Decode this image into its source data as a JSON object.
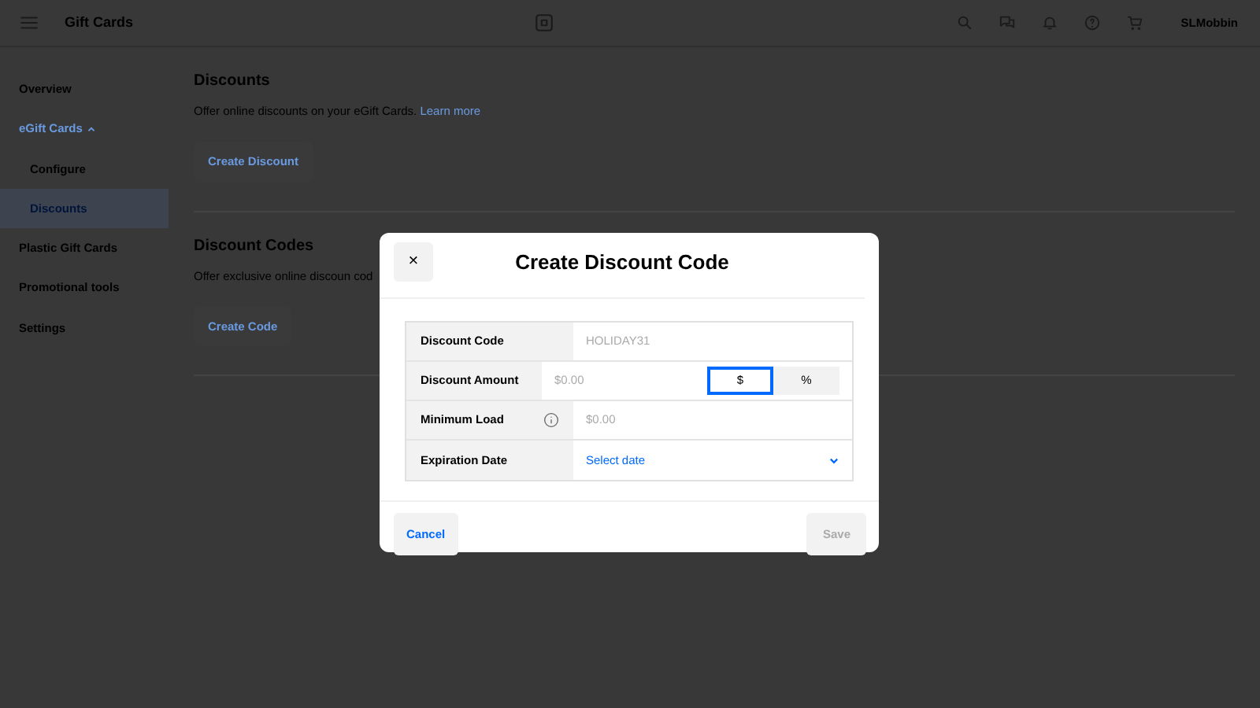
{
  "top_bar": {
    "title": "Gift Cards",
    "account": "SLMobbin"
  },
  "sidebar": {
    "items": [
      {
        "label": "Overview",
        "selected": false
      },
      {
        "label": "eGift Cards",
        "selected": false,
        "expanded": true,
        "children": [
          {
            "label": "Configure",
            "selected": false
          },
          {
            "label": "Discounts",
            "selected": true
          }
        ]
      },
      {
        "label": "Plastic Gift Cards",
        "selected": false
      },
      {
        "label": "Promotional tools",
        "selected": false
      },
      {
        "label": "Settings",
        "selected": false
      }
    ]
  },
  "sections": [
    {
      "title": "Discounts",
      "description": "Offer online discounts on your eGift Cards.",
      "link": "Learn more",
      "button": "Create Discount"
    },
    {
      "title": "Discount Codes",
      "description": "Offer exclusive online discoun cod",
      "button": "Create Code"
    }
  ],
  "dialog": {
    "close": "×",
    "title": "Create Discount Code",
    "fields": [
      {
        "kind": "text",
        "label": "Discount Code",
        "placeholder": "HOLIDAY31"
      },
      {
        "kind": "amount",
        "label": "Discount Amount",
        "placeholder": "$0.00",
        "units": [
          {
            "label": "$",
            "selected": true
          },
          {
            "label": "%",
            "selected": false
          }
        ]
      },
      {
        "kind": "info",
        "label": "Minimum Load",
        "placeholder": "$0.00"
      },
      {
        "kind": "select",
        "label": "Expiration Date",
        "value": "Select date"
      }
    ],
    "cancel": "Cancel",
    "save": {
      "label": "Save",
      "disabled": true
    }
  }
}
